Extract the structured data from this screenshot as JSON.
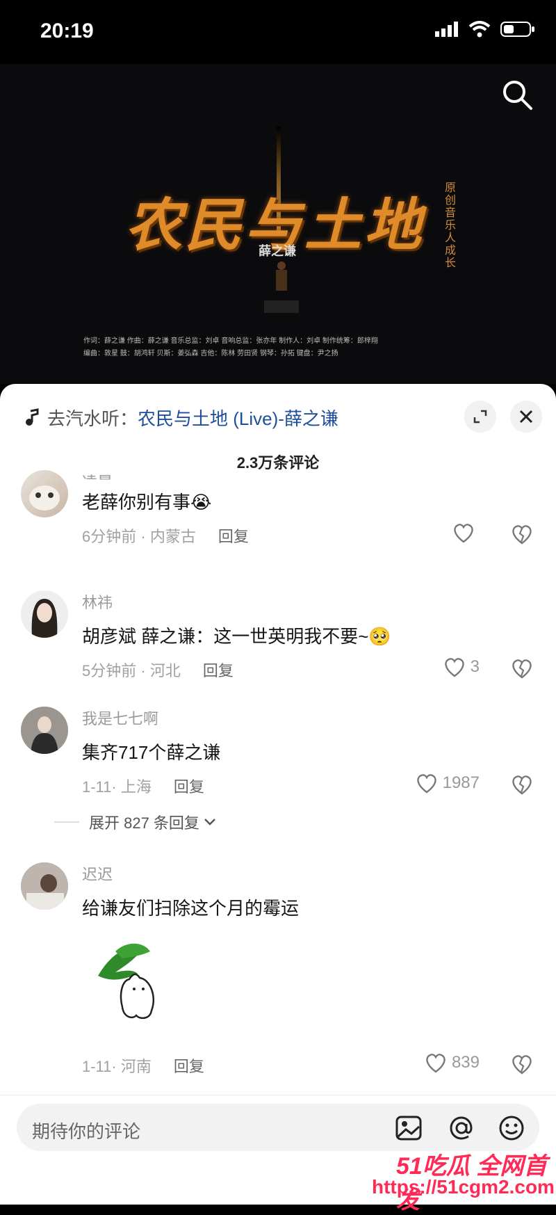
{
  "status_bar": {
    "time": "20:19"
  },
  "video_poster": {
    "title": "农民与土地",
    "side_text": "原创音乐人 成长",
    "singer": "薛之谦",
    "credits_line1": "作词：薛之谦   作曲：薛之谦   音乐总监：刘卓   音响总监：张亦年   制作人：刘卓   制作统筹：郎梓翔",
    "credits_line2": "编曲：敦星   鼓：胡鸿轩   贝斯：姜弘森   吉他：陈林 劳田贤   钢琴：孙拓   键盘：尹之扬"
  },
  "music_link": {
    "prefix": "去汽水听：",
    "song": "农民与土地 (Live)-薛之谦"
  },
  "comment_count": "2.3万条评论",
  "comments": [
    {
      "username": "凌晨",
      "text": "老薛你别有事😭",
      "time": "6分钟前",
      "location": "内蒙古",
      "reply": "回复",
      "likes": ""
    },
    {
      "username": "林祎",
      "text": "胡彦斌 薛之谦：这一世英明我不要~🥺",
      "time": "5分钟前",
      "location": "河北",
      "reply": "回复",
      "likes": "3"
    },
    {
      "username": "我是七七啊",
      "text": "集齐717个薛之谦",
      "time": "1-11",
      "location": "上海",
      "reply": "回复",
      "likes": "1987",
      "expand": "展开 827 条回复"
    },
    {
      "username": "迟迟",
      "text": "给谦友们扫除这个月的霉运",
      "time": "1-11",
      "location": "河南",
      "reply": "回复",
      "likes": "839"
    }
  ],
  "input": {
    "placeholder": "期待你的评论"
  },
  "watermark": {
    "brand": "51吃瓜 全网首发",
    "url": "https://51cgm2.com"
  },
  "icons": [
    "signal-icon",
    "wifi-icon",
    "battery-icon",
    "search-icon",
    "music-note-icon",
    "expand-icon",
    "close-icon",
    "heart-icon",
    "broken-heart-icon",
    "image-icon",
    "at-icon",
    "emoji-icon"
  ]
}
